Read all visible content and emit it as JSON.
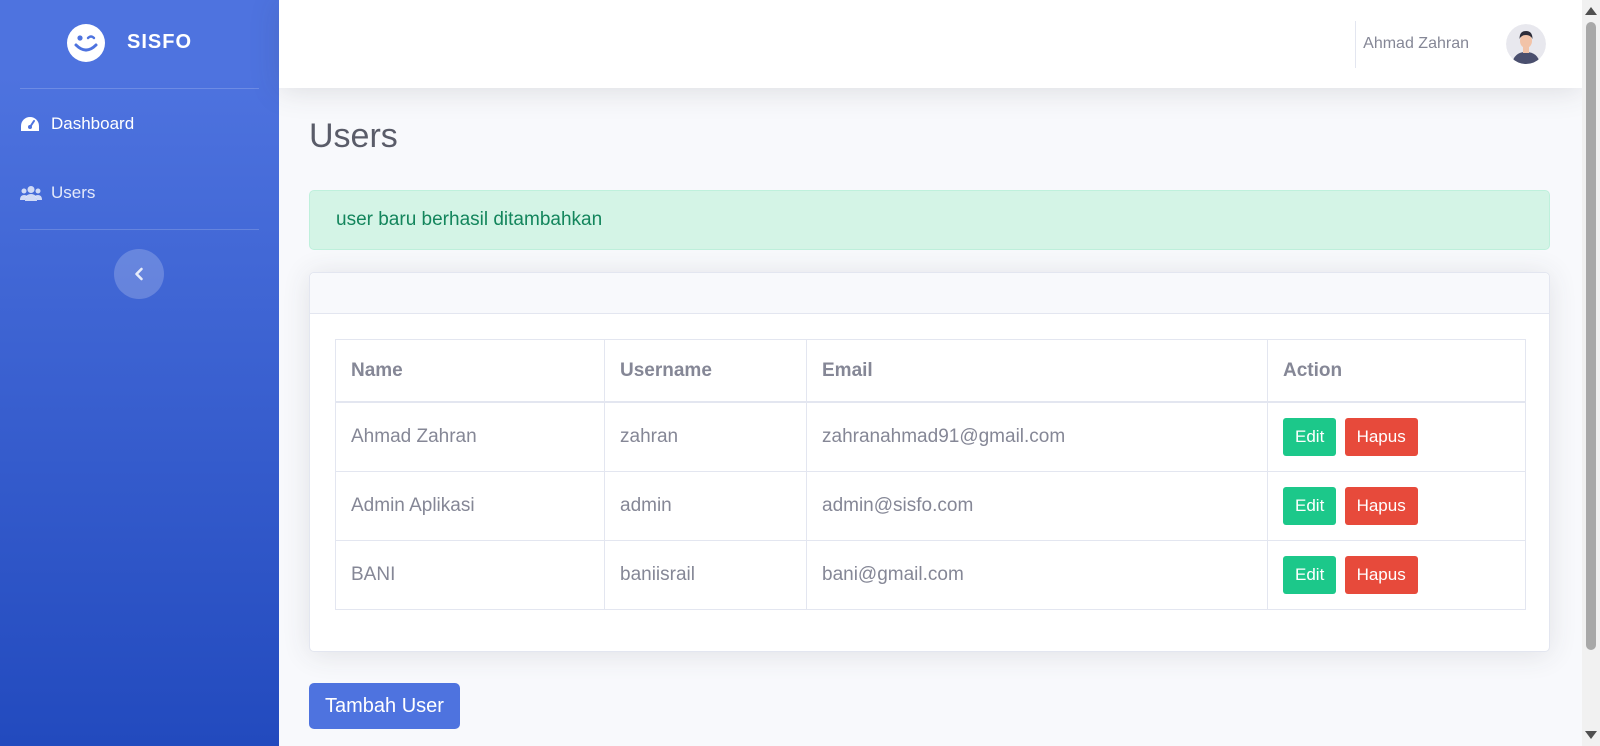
{
  "brand": {
    "name": "SISFO",
    "icon": "wink-face-icon"
  },
  "sidebar": {
    "items": [
      {
        "label": "Dashboard",
        "icon": "tachometer-icon"
      },
      {
        "label": "Users",
        "icon": "users-icon"
      }
    ],
    "toggle_icon": "chevron-left-icon"
  },
  "topbar": {
    "user_name": "Ahmad Zahran",
    "avatar_icon": "user-avatar-icon"
  },
  "main": {
    "title": "Users",
    "alert": "user baru berhasil ditambahkan",
    "table": {
      "headers": [
        "Name",
        "Username",
        "Email",
        "Action"
      ],
      "rows": [
        {
          "name": "Ahmad Zahran",
          "username": "zahran",
          "email": "zahranahmad91@gmail.com"
        },
        {
          "name": "Admin Aplikasi",
          "username": "admin",
          "email": "admin@sisfo.com"
        },
        {
          "name": "BANI",
          "username": "baniisrail",
          "email": "bani@gmail.com"
        }
      ],
      "edit_label": "Edit",
      "delete_label": "Hapus"
    },
    "add_button": "Tambah User"
  },
  "colors": {
    "primary": "#4e73df",
    "success": "#1cc88a",
    "danger": "#e74a3b",
    "alert_bg": "#d4f4e6",
    "alert_text": "#13855c"
  }
}
